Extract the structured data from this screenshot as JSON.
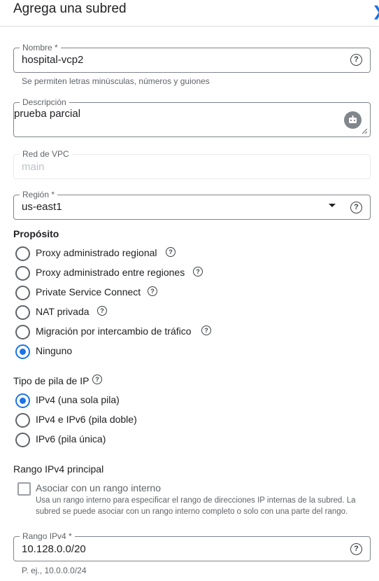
{
  "panel": {
    "title": "Agrega una subred"
  },
  "name_field": {
    "label": "Nombre *",
    "value": "hospital-vcp2",
    "hint": "Se permiten letras minúsculas, números y guiones"
  },
  "description_field": {
    "label": "Descripción",
    "value": "prueba parcial"
  },
  "vpc_field": {
    "label": "Red de VPC",
    "value": "main"
  },
  "region_field": {
    "label": "Región *",
    "value": "us-east1"
  },
  "purpose": {
    "title": "Propósito",
    "options": [
      {
        "label": "Proxy administrado regional",
        "selected": false
      },
      {
        "label": "Proxy administrado entre regiones",
        "selected": false
      },
      {
        "label": "Private Service Connect",
        "selected": false
      },
      {
        "label": "NAT privada",
        "selected": false
      },
      {
        "label": "Migración por intercambio de tráfico",
        "selected": false
      },
      {
        "label": "Ninguno",
        "selected": true
      }
    ]
  },
  "ip_stack": {
    "title": "Tipo de pila de IP",
    "options": [
      {
        "label": "IPv4 (una sola pila)",
        "selected": true
      },
      {
        "label": "IPv4 e IPv6 (pila doble)",
        "selected": false
      },
      {
        "label": "IPv6 (pila única)",
        "selected": false
      }
    ]
  },
  "primary_range": {
    "title": "Rango IPv4 principal",
    "checkbox_label": "Asociar con un rango interno",
    "checkbox_checked": false,
    "description_line1": "Usa un rango interno para especificar el rango de direcciones IP internas de la subred. La",
    "description_line2": "subred se puede asociar con un rango interno completo o solo con una parte del rango."
  },
  "ipv4_range_field": {
    "label": "Rango IPv4 *",
    "value": "10.128.0.0/20",
    "hint": "P. ej., 10.0.0.0/24"
  },
  "colors": {
    "accent": "#1a73e8",
    "border": "#80868b",
    "muted_text": "#5f6368"
  }
}
